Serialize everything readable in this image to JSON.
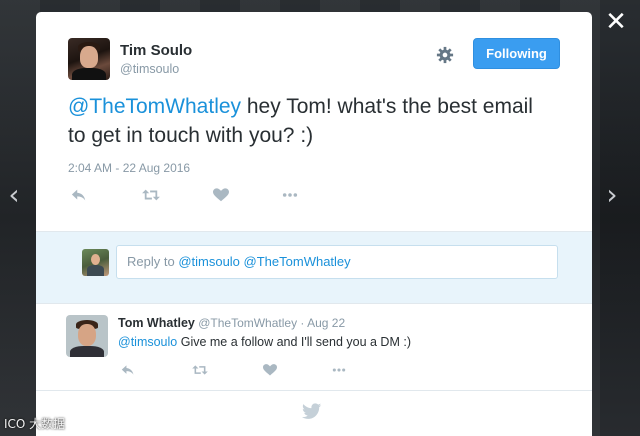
{
  "tweet": {
    "author_name": "Tim Soulo",
    "author_handle": "@timsoulo",
    "follow_label": "Following",
    "text_mention": "@TheTomWhatley",
    "text_rest": " hey Tom! what's the best email to get in touch with you? :)",
    "timestamp": "2:04 AM - 22 Aug 2016"
  },
  "reply_box": {
    "prefix": "Reply to ",
    "mention1": "@timsoulo",
    "mention2": "@TheTomWhatley"
  },
  "reply_tweet": {
    "author_name": "Tom Whatley",
    "author_handle": "@TheTomWhatley",
    "date": "Aug 22",
    "separator": " · ",
    "text_mention": "@timsoulo",
    "text_rest": " Give me a follow and I'll send you a DM :)"
  },
  "close_glyph": "✕",
  "prev_glyph": "‹",
  "next_glyph": "›",
  "watermark": "ICO 大数据",
  "colors": {
    "accent": "#1a91da",
    "follow_button": "#3a9df0",
    "reply_bg": "#e8f4fb"
  },
  "icons": [
    "gear-icon",
    "reply-icon",
    "retweet-icon",
    "like-icon",
    "more-icon",
    "twitter-bird-icon",
    "close-icon"
  ]
}
